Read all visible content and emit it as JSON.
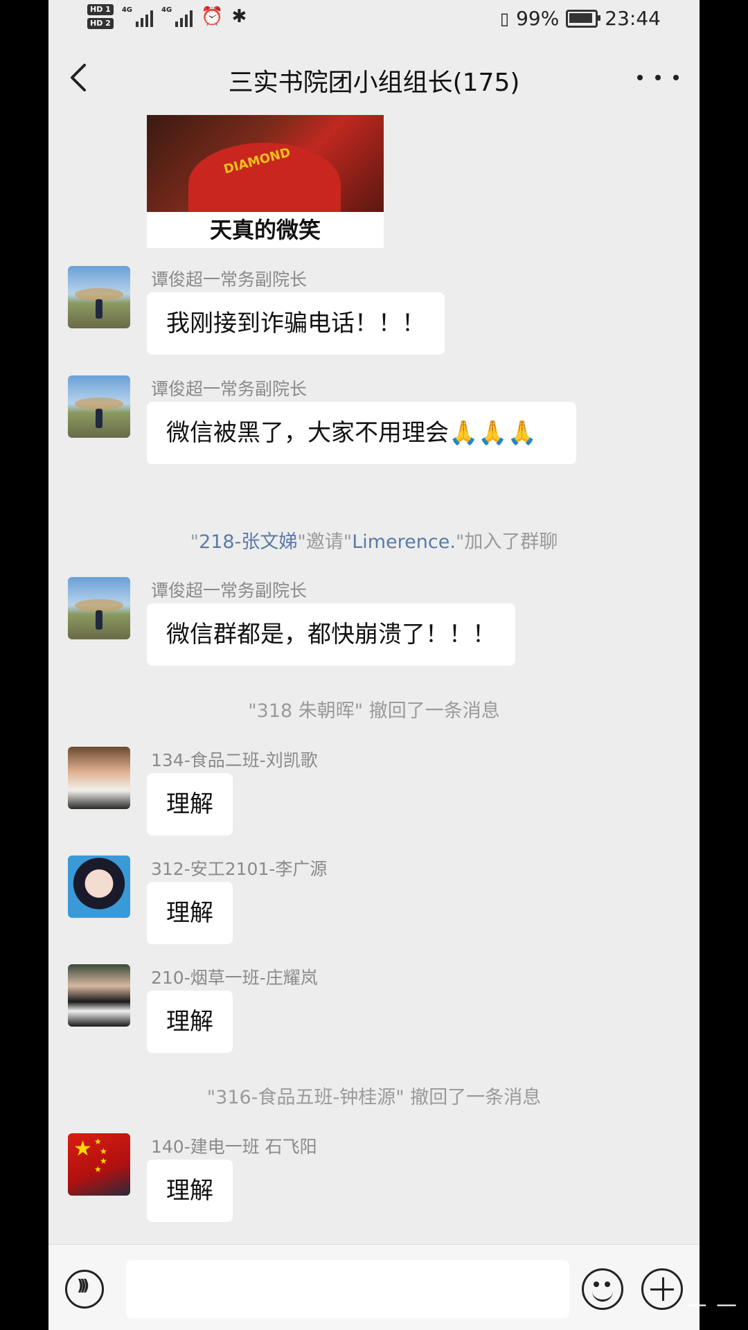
{
  "status": {
    "battery": "99%",
    "time": "23:44"
  },
  "header": {
    "title": "三实书院团小组组长(175)"
  },
  "image_message": {
    "caption": "天真的微笑",
    "shirt_text": "DIAMOND"
  },
  "messages": [
    {
      "sender": "谭俊超一常务副院长",
      "text": "我刚接到诈骗电话！！！"
    },
    {
      "sender": "谭俊超一常务副院长",
      "text": "微信被黑了，大家不用理会",
      "emoji": "🙏🙏🙏"
    },
    {
      "sender": "谭俊超一常务副院长",
      "text": "微信群都是，都快崩溃了！！！"
    },
    {
      "sender": "134-食品二班-刘凯歌",
      "text": "理解"
    },
    {
      "sender": "312-安工2101-李广源",
      "text": "理解"
    },
    {
      "sender": "210-烟草一班-庄耀岚",
      "text": "理解"
    },
    {
      "sender": "140-建电一班 石飞阳",
      "text": "理解"
    }
  ],
  "system": {
    "invite_open": "\"",
    "invite_inviter": "218-张文娣",
    "invite_mid": "\"邀请\"",
    "invite_invitee": "Limerence.",
    "invite_end": "\"加入了群聊",
    "recall_1": "\"318 朱朝晖\" 撤回了一条消息",
    "recall_2": "\"316-食品五班-钟桂源\" 撤回了一条消息"
  }
}
